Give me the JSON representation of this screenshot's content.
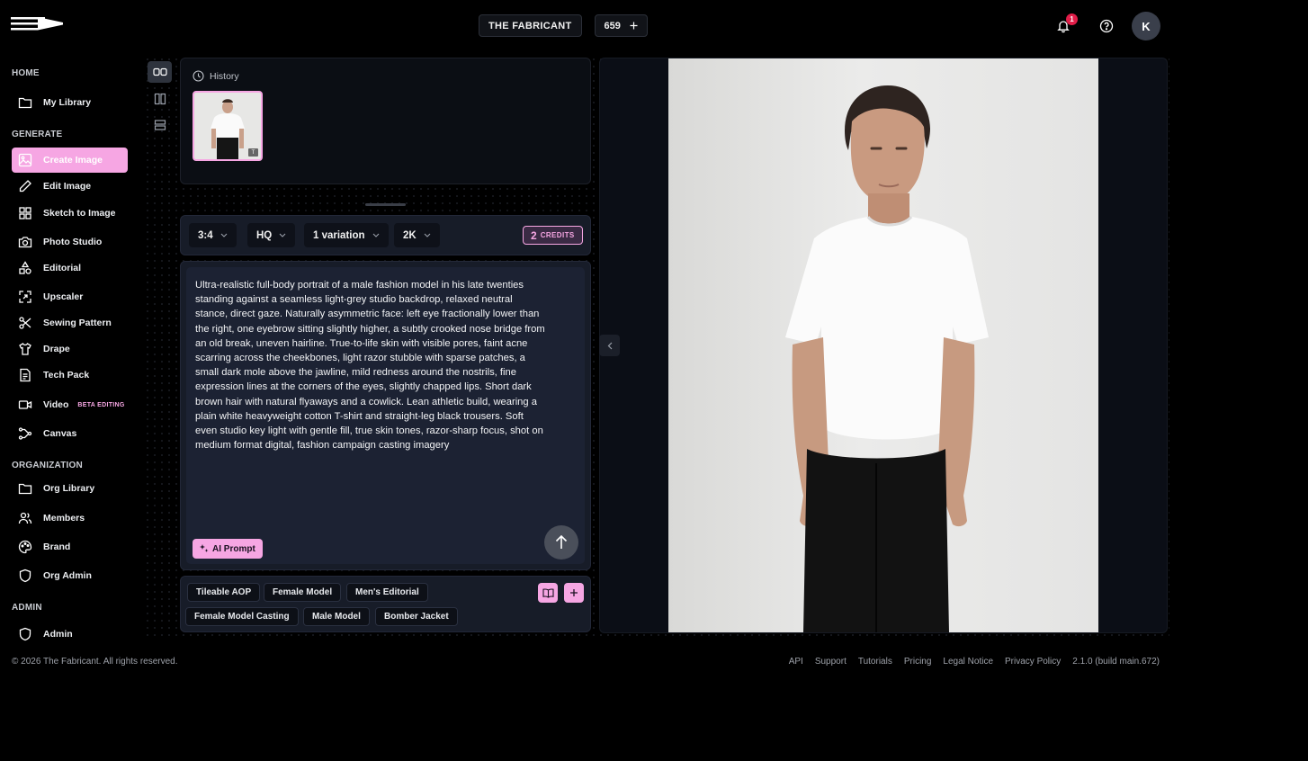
{
  "header": {
    "org_name": "THE FABRICANT",
    "credits": "659",
    "notifications_count": "1",
    "avatar_initial": "K"
  },
  "sidebar": {
    "sections": {
      "home": "HOME",
      "generate": "GENERATE",
      "organization": "ORGANIZATION",
      "admin": "ADMIN"
    },
    "items": [
      {
        "label": "My Library",
        "icon": "folder-icon"
      },
      {
        "label": "Create Image",
        "icon": "image-icon",
        "active": true
      },
      {
        "label": "Edit Image",
        "icon": "pencil-icon"
      },
      {
        "label": "Sketch to Image",
        "icon": "grid-icon"
      },
      {
        "label": "Photo Studio",
        "icon": "camera-icon"
      },
      {
        "label": "Editorial",
        "icon": "shapes-icon"
      },
      {
        "label": "Upscaler",
        "icon": "upscale-icon"
      },
      {
        "label": "Sewing Pattern",
        "icon": "scissors-icon"
      },
      {
        "label": "Drape",
        "icon": "shirt-icon"
      },
      {
        "label": "Tech Pack",
        "icon": "document-icon"
      },
      {
        "label": "Video",
        "icon": "video-icon",
        "badge": "BETA EDITING"
      },
      {
        "label": "Canvas",
        "icon": "workflow-icon"
      },
      {
        "label": "Org Library",
        "icon": "folder-icon"
      },
      {
        "label": "Members",
        "icon": "users-icon"
      },
      {
        "label": "Brand",
        "icon": "palette-icon"
      },
      {
        "label": "Org Admin",
        "icon": "shield-icon"
      },
      {
        "label": "Admin",
        "icon": "shield-icon"
      }
    ]
  },
  "history": {
    "title": "History",
    "thumb_badge": "T"
  },
  "options": {
    "aspect_ratio": "3:4",
    "quality": "HQ",
    "variations": "1 variation",
    "resolution": "2K",
    "credits_num": "2",
    "credits_label": "CREDITS"
  },
  "prompt": {
    "text": "Ultra-realistic full-body portrait of a male fashion model in his late twenties standing against a seamless light-grey studio backdrop, relaxed neutral stance, direct gaze. Naturally asymmetric face: left eye fractionally lower than the right, one eyebrow sitting slightly higher, a subtly crooked nose bridge from an old break, uneven hairline. True-to-life skin with visible pores, faint acne scarring across the cheekbones, light razor stubble with sparse patches, a small dark mole above the jawline, mild redness around the nostrils, fine expression lines at the corners of the eyes, slightly chapped lips. Short dark brown hair with natural flyaways and a cowlick. Lean athletic build, wearing a plain white heavyweight cotton T-shirt and straight-leg black trousers. Soft even studio key light with gentle fill, true skin tones, razor-sharp focus, shot on medium format digital, fashion campaign casting imagery",
    "ai_prompt_label": "AI Prompt"
  },
  "presets": [
    "Tileable AOP",
    "Female Model",
    "Men's Editorial",
    "Female Model Casting",
    "Male Model",
    "Bomber Jacket"
  ],
  "footer": {
    "copyright": "© 2026 The Fabricant. All rights reserved.",
    "links": [
      "API",
      "Support",
      "Tutorials",
      "Pricing",
      "Legal Notice",
      "Privacy Policy",
      "2.1.0 (build main.672)"
    ]
  },
  "colors": {
    "accent": "#f6a6e3",
    "background": "#000000",
    "panel": "#171c28"
  }
}
